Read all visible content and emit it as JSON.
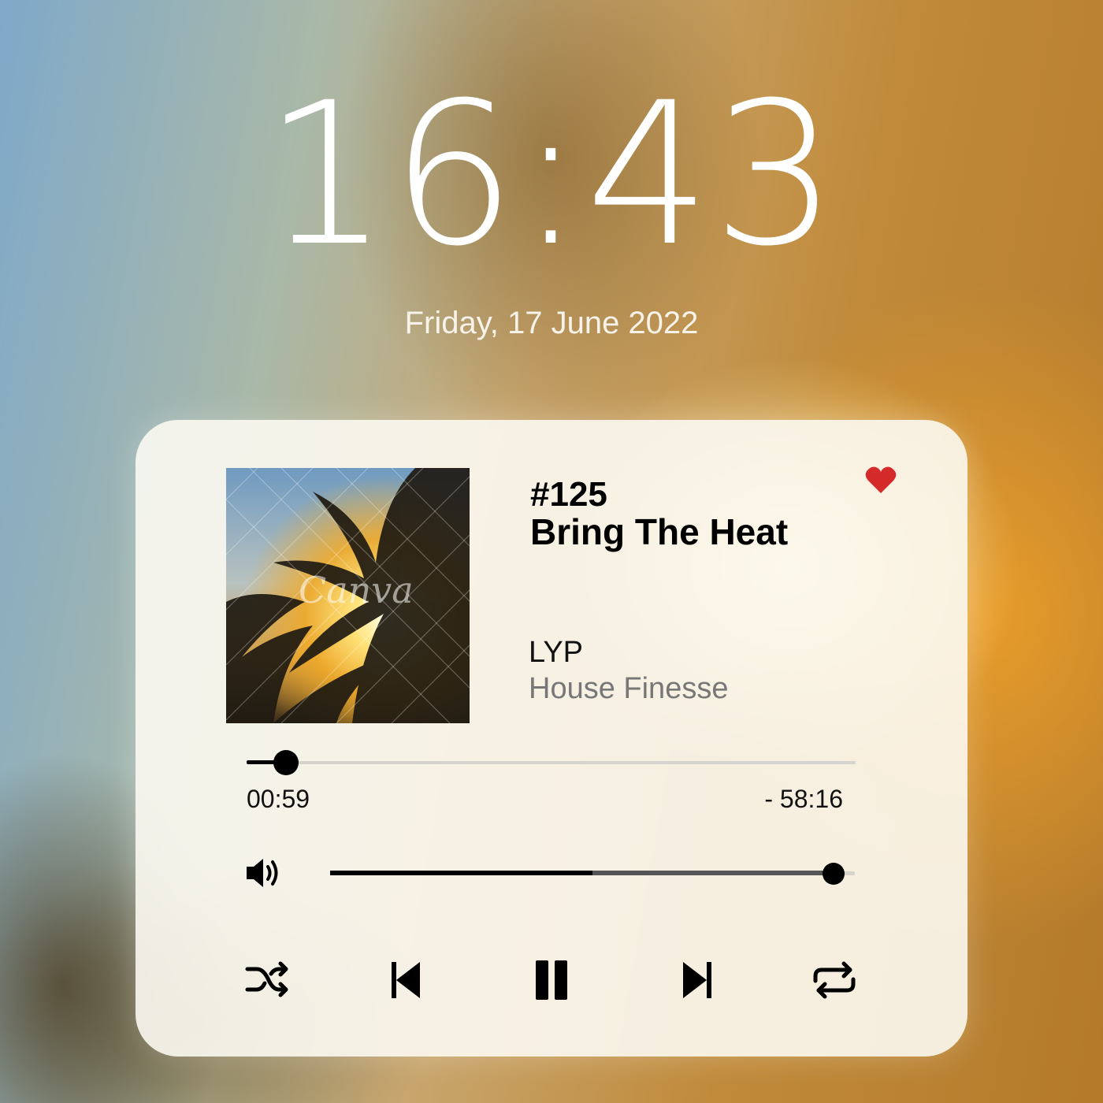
{
  "lock_screen": {
    "time": "16:43",
    "date": "Friday, 17 June 2022"
  },
  "player": {
    "cover_watermark": "Canva",
    "episode": "#125",
    "title": "Bring The Heat",
    "artist": "LYP",
    "album": "House Finesse",
    "liked": true,
    "progress": {
      "elapsed": "00:59",
      "remaining": "- 58:16",
      "fraction": 0.065
    },
    "volume": {
      "level": 0.96,
      "buffer_split": 0.5
    },
    "controls": {
      "shuffle_icon": "shuffle-icon",
      "previous_icon": "skip-previous-icon",
      "pause_icon": "pause-icon",
      "next_icon": "skip-next-icon",
      "repeat_icon": "repeat-icon"
    },
    "colors": {
      "heart": "#d42a2a",
      "accent": "#000000"
    }
  }
}
